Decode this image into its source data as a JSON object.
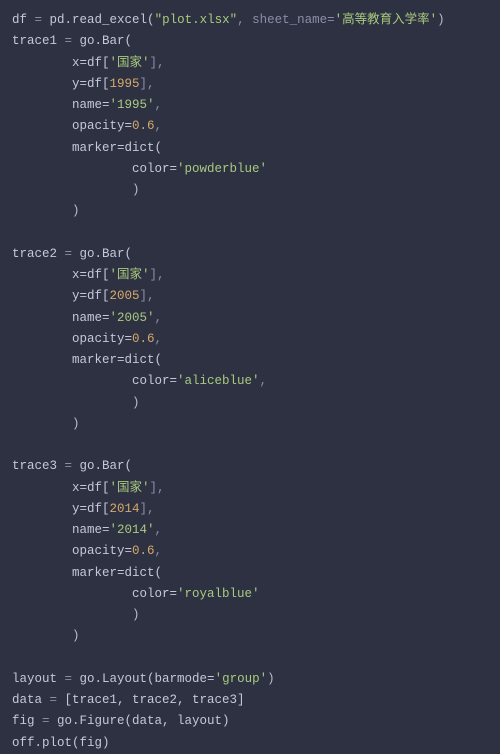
{
  "code": {
    "l01": {
      "a": "df",
      "b": " = ",
      "c": "pd.read_excel(",
      "d": "\"plot.xlsx\"",
      "e": ", sheet_name=",
      "f": "'高等教育入学率'",
      "g": ")"
    },
    "l02": {
      "a": "trace1",
      "b": " = ",
      "c": "go.Bar("
    },
    "l03": {
      "a": "        x=df[",
      "b": "'国家'",
      "c": "],"
    },
    "l04": {
      "a": "        y=df[",
      "b": "1995",
      "c": "],"
    },
    "l05": {
      "a": "        name=",
      "b": "'1995'",
      "c": ","
    },
    "l06": {
      "a": "        opacity=",
      "b": "0.6",
      "c": ","
    },
    "l07": {
      "a": "        marker=dict("
    },
    "l08": {
      "a": "                color=",
      "b": "'powderblue'"
    },
    "l09": {
      "a": "                )"
    },
    "l10": {
      "a": "        )"
    },
    "blank1": "",
    "l11": {
      "a": "trace2",
      "b": " = ",
      "c": "go.Bar("
    },
    "l12": {
      "a": "        x=df[",
      "b": "'国家'",
      "c": "],"
    },
    "l13": {
      "a": "        y=df[",
      "b": "2005",
      "c": "],"
    },
    "l14": {
      "a": "        name=",
      "b": "'2005'",
      "c": ","
    },
    "l15": {
      "a": "        opacity=",
      "b": "0.6",
      "c": ","
    },
    "l16": {
      "a": "        marker=dict("
    },
    "l17": {
      "a": "                color=",
      "b": "'aliceblue'",
      "c": ","
    },
    "l18": {
      "a": "                )"
    },
    "l19": {
      "a": "        )"
    },
    "blank2": "",
    "l20": {
      "a": "trace3",
      "b": " = ",
      "c": "go.Bar("
    },
    "l21": {
      "a": "        x=df[",
      "b": "'国家'",
      "c": "],"
    },
    "l22": {
      "a": "        y=df[",
      "b": "2014",
      "c": "],"
    },
    "l23": {
      "a": "        name=",
      "b": "'2014'",
      "c": ","
    },
    "l24": {
      "a": "        opacity=",
      "b": "0.6",
      "c": ","
    },
    "l25": {
      "a": "        marker=dict("
    },
    "l26": {
      "a": "                color=",
      "b": "'royalblue'"
    },
    "l27": {
      "a": "                )"
    },
    "l28": {
      "a": "        )"
    },
    "blank3": "",
    "l29": {
      "a": "layout",
      "b": " = ",
      "c": "go.Layout(barmode=",
      "d": "'group'",
      "e": ")"
    },
    "l30": {
      "a": "data",
      "b": " = ",
      "c": "[trace1, trace2, trace3]"
    },
    "l31": {
      "a": "fig",
      "b": " = ",
      "c": "go.Figure(data, layout)"
    },
    "l32": {
      "a": "off.plot(fig)"
    }
  }
}
